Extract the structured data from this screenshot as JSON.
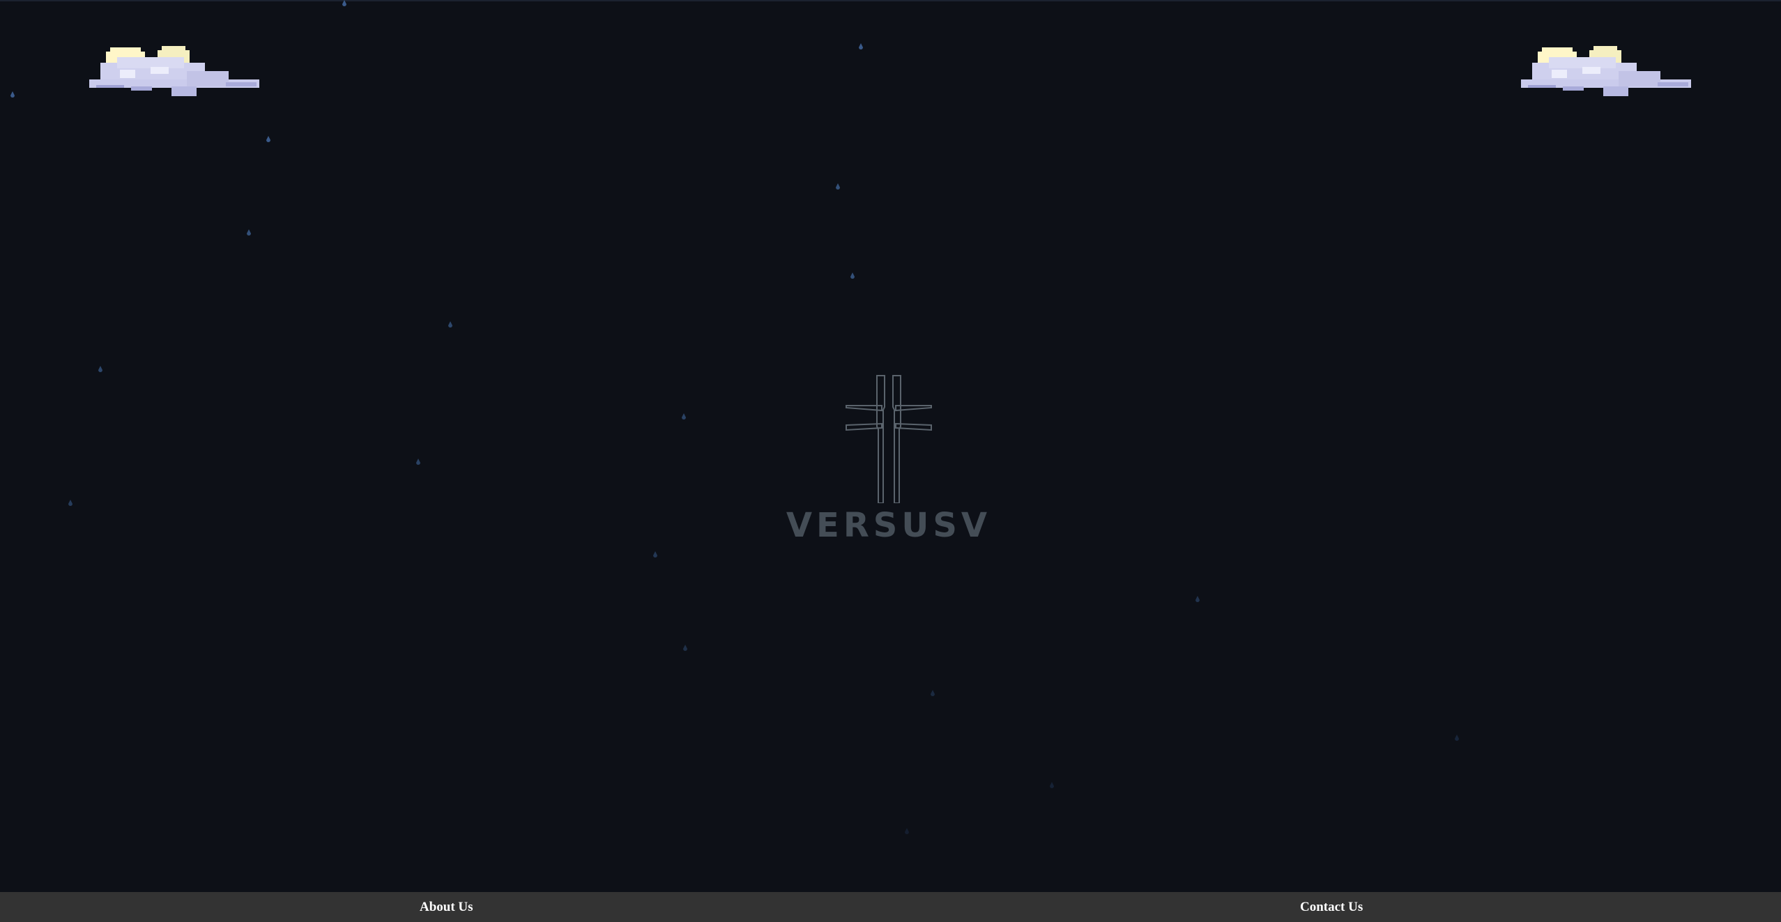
{
  "brand": {
    "wordmark": "VERSUSV",
    "logo_icon": "cross-icon",
    "wordmark_color": "#444d56",
    "icon_stroke_color": "#5a636c"
  },
  "decor": {
    "cloud_icon": "cloud-moon-icon",
    "rain_icon": "raindrop-icon",
    "background_color": "#0d1017",
    "rain_color": "#3a5a8a"
  },
  "footer": {
    "background_color": "#333333",
    "about_label": "About Us",
    "contact_label": "Contact Us"
  }
}
